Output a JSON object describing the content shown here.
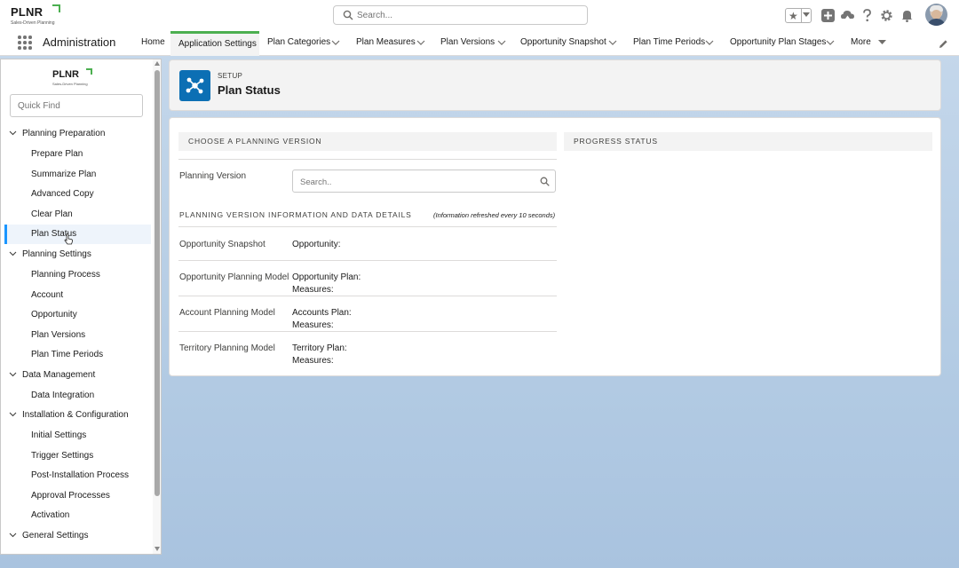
{
  "brand": {
    "logo_text": "PLNR",
    "tagline": "Sales-Driven Planning"
  },
  "header": {
    "search_placeholder": "Search...",
    "icons": [
      "favorites-star-icon",
      "add-icon",
      "trailhead-icon",
      "help-icon",
      "setup-gear-icon",
      "notifications-bell-icon",
      "user-avatar"
    ]
  },
  "nav": {
    "app_name": "Administration",
    "tabs": [
      {
        "label": "Home",
        "has_menu": false,
        "active": false
      },
      {
        "label": "Application Settings",
        "has_menu": false,
        "active": true
      },
      {
        "label": "Plan Categories",
        "has_menu": true,
        "active": false
      },
      {
        "label": "Plan Measures",
        "has_menu": true,
        "active": false
      },
      {
        "label": "Plan Versions",
        "has_menu": true,
        "active": false
      },
      {
        "label": "Opportunity Snapshot",
        "has_menu": true,
        "active": false
      },
      {
        "label": "Plan Time Periods",
        "has_menu": true,
        "active": false
      },
      {
        "label": "Opportunity Plan Stages",
        "has_menu": true,
        "active": false
      },
      {
        "label": "More",
        "has_menu": true,
        "active": false
      }
    ]
  },
  "sidebar": {
    "quick_find_placeholder": "Quick Find",
    "sections": [
      {
        "label": "Planning Preparation",
        "items": [
          "Prepare Plan",
          "Summarize Plan",
          "Advanced Copy",
          "Clear Plan",
          "Plan Status"
        ]
      },
      {
        "label": "Planning Settings",
        "items": [
          "Planning Process",
          "Account",
          "Opportunity",
          "Plan Versions",
          "Plan Time Periods"
        ]
      },
      {
        "label": "Data Management",
        "items": [
          "Data Integration"
        ]
      },
      {
        "label": "Installation & Configuration",
        "items": [
          "Initial Settings",
          "Trigger Settings",
          "Post-Installation Process",
          "Approval Processes",
          "Activation"
        ]
      },
      {
        "label": "General Settings",
        "items": []
      }
    ],
    "selected_item": "Plan Status"
  },
  "page": {
    "eyebrow": "SETUP",
    "title": "Plan Status"
  },
  "main": {
    "choose_version_heading": "CHOOSE A PLANNING VERSION",
    "progress_heading": "PROGRESS STATUS",
    "planning_version_label": "Planning Version",
    "planning_version_placeholder": "Search..",
    "info_heading": "PLANNING VERSION INFORMATION AND DATA DETAILS",
    "info_note": "(Information refreshed every 10 seconds)",
    "rows": [
      {
        "label": "Opportunity Snapshot",
        "values": [
          "Opportunity:"
        ]
      },
      {
        "label": "Opportunity Planning Model",
        "values": [
          "Opportunity Plan:",
          "Measures:"
        ]
      },
      {
        "label": "Account Planning Model",
        "values": [
          "Accounts Plan:",
          "Measures:"
        ]
      },
      {
        "label": "Territory Planning Model",
        "values": [
          "Territory Plan:",
          "Measures:"
        ]
      }
    ]
  },
  "colors": {
    "accent_green": "#4caf50",
    "brand_blue": "#0c6fb4",
    "selection_blue": "#1b96ff"
  }
}
